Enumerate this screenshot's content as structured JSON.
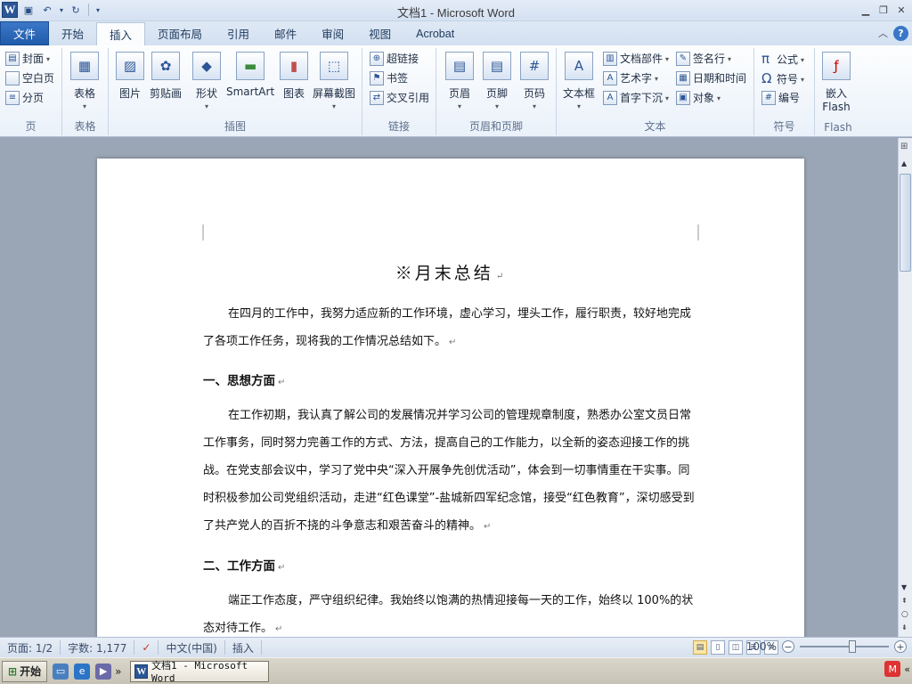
{
  "window": {
    "title": "文档1  -  Microsoft Word",
    "app_icon": "word-icon"
  },
  "quick_access": {
    "items": [
      "save-icon",
      "undo-icon",
      "redo-icon",
      "customize-icon"
    ]
  },
  "tabs": [
    {
      "label": "文件",
      "active": false,
      "file": true
    },
    {
      "label": "开始",
      "active": false
    },
    {
      "label": "插入",
      "active": true
    },
    {
      "label": "页面布局",
      "active": false
    },
    {
      "label": "引用",
      "active": false
    },
    {
      "label": "邮件",
      "active": false
    },
    {
      "label": "审阅",
      "active": false
    },
    {
      "label": "视图",
      "active": false
    },
    {
      "label": "Acrobat",
      "active": false
    }
  ],
  "ribbon": {
    "groups": {
      "pages": {
        "label": "页",
        "items": [
          "封面",
          "空白页",
          "分页"
        ]
      },
      "tables": {
        "label": "表格",
        "items": [
          "表格"
        ]
      },
      "illustrations": {
        "label": "插图",
        "items": [
          "图片",
          "剪贴画",
          "形状",
          "SmartArt",
          "图表",
          "屏幕截图"
        ]
      },
      "links": {
        "label": "链接",
        "items": [
          "超链接",
          "书签",
          "交叉引用"
        ]
      },
      "header_footer": {
        "label": "页眉和页脚",
        "items": [
          "页眉",
          "页脚",
          "页码"
        ]
      },
      "text": {
        "label": "文本",
        "items": [
          "文本框",
          "文档部件",
          "艺术字",
          "首字下沉",
          "签名行",
          "日期和时间",
          "对象"
        ]
      },
      "symbols": {
        "label": "符号",
        "items": [
          "公式",
          "符号",
          "编号"
        ]
      },
      "flash": {
        "label": "Flash",
        "items": [
          "嵌入",
          "Flash"
        ]
      }
    }
  },
  "document": {
    "title": "※月末总结",
    "para1": "在四月的工作中，我努力适应新的工作环境，虚心学习，埋头工作，履行职责，较好地完成了各项工作任务，现将我的工作情况总结如下。",
    "heading1": "一、思想方面",
    "para2": "在工作初期，我认真了解公司的发展情况并学习公司的管理规章制度，熟悉办公室文员日常工作事务，同时努力完善工作的方式、方法，提高自己的工作能力，以全新的姿态迎接工作的挑战。在党支部会议中，学习了党中央“深入开展争先创优活动”，体会到一切事情重在干实事。同时积极参加公司党组织活动，走进“红色课堂”-盐城新四军纪念馆，接受“红色教育”，深切感受到了共产党人的百折不挠的斗争意志和艰苦奋斗的精神。",
    "heading2": "二、工作方面",
    "para3": "端正工作态度，严守组织纪律。我始终以饱满的热情迎接每一天的工作，始终以 100%的状态对待工作。",
    "para_mark": "↵"
  },
  "status": {
    "page": "页面: 1/2",
    "words": "字数: 1,177",
    "language": "中文(中国)",
    "mode": "插入",
    "zoom": "100%"
  },
  "taskbar": {
    "start": "开始",
    "window_label": "文档1 - Microsoft Word",
    "chevron": "»"
  }
}
